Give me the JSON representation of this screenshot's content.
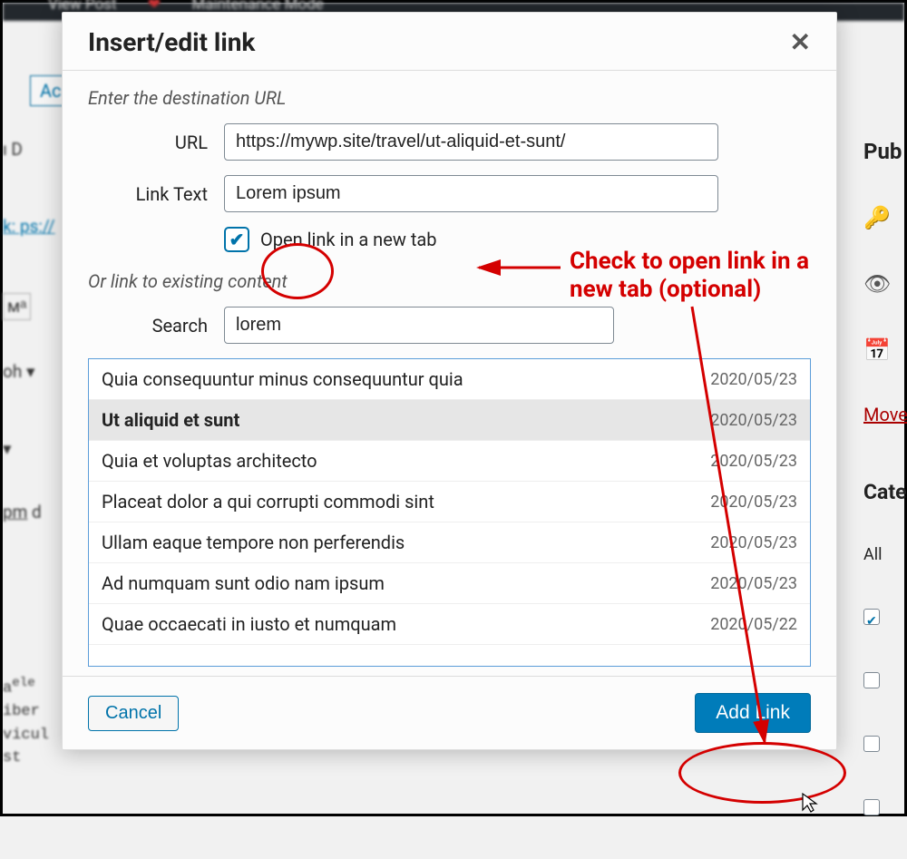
{
  "background": {
    "topbar": {
      "viewPost": "View Post",
      "maintenance": "Maintenance Mode"
    },
    "addBtn": "Ac",
    "rightSidebar": {
      "pub": "Pub",
      "move": "Move",
      "cat": "Cate",
      "all": "All"
    }
  },
  "dialog": {
    "title": "Insert/edit link",
    "hint1": "Enter the destination URL",
    "urlLabel": "URL",
    "urlValue": "https://mywp.site/travel/ut-aliquid-et-sunt/",
    "textLabel": "Link Text",
    "textValue": "Lorem ipsum",
    "newTabLabel": "Open link in a new tab",
    "newTabChecked": true,
    "hint2": "Or link to existing content",
    "searchLabel": "Search",
    "searchValue": "lorem",
    "results": [
      {
        "title": "Quia consequuntur minus consequuntur quia",
        "date": "2020/05/23",
        "selected": false
      },
      {
        "title": "Ut aliquid et sunt",
        "date": "2020/05/23",
        "selected": true
      },
      {
        "title": "Quia et voluptas architecto",
        "date": "2020/05/23",
        "selected": false
      },
      {
        "title": "Placeat dolor a qui corrupti commodi sint",
        "date": "2020/05/23",
        "selected": false
      },
      {
        "title": "Ullam eaque tempore non perferendis",
        "date": "2020/05/23",
        "selected": false
      },
      {
        "title": "Ad numquam sunt odio nam ipsum",
        "date": "2020/05/23",
        "selected": false
      },
      {
        "title": "Quae occaecati in iusto et numquam",
        "date": "2020/05/22",
        "selected": false
      }
    ],
    "cancel": "Cancel",
    "submit": "Add Link"
  },
  "annotation": {
    "text": "Check to open link in a new tab (optional)"
  }
}
